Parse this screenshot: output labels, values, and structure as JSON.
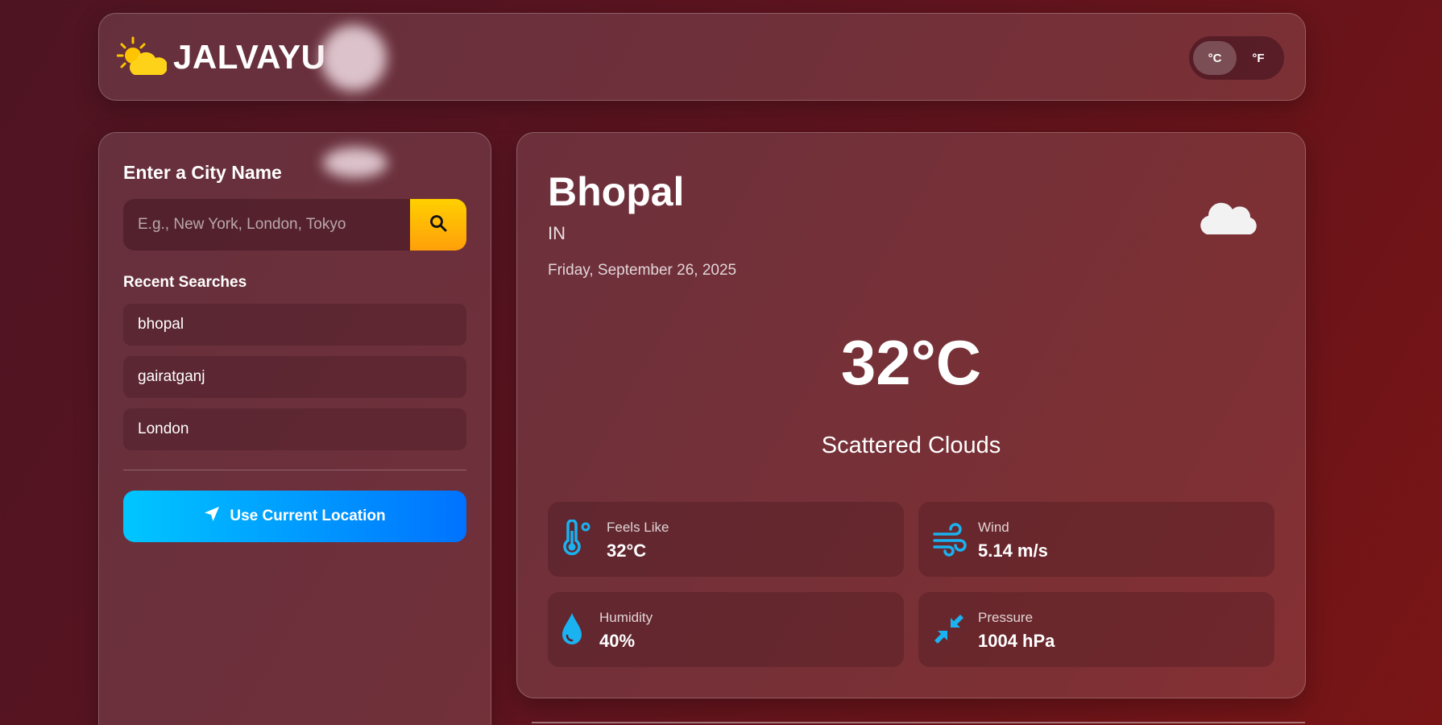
{
  "app": {
    "name": "JALVAYU",
    "icon": "sun-cloud-icon"
  },
  "units": {
    "celsius_label": "°C",
    "fahrenheit_label": "°F",
    "selected": "°C"
  },
  "sidebar": {
    "title": "Enter a City Name",
    "search_placeholder": "E.g., New York, London, Tokyo",
    "search_value": "",
    "recent_title": "Recent Searches",
    "recent": [
      "bhopal",
      "gairatganj",
      "London"
    ],
    "location_button": "Use Current Location"
  },
  "weather": {
    "city": "Bhopal",
    "country": "IN",
    "date": "Friday, September 26, 2025",
    "temperature": "32°C",
    "description": "Scattered Clouds",
    "icon": "cloud-icon",
    "stats": {
      "feels_like": {
        "label": "Feels Like",
        "value": "32°C",
        "icon": "thermometer-icon"
      },
      "wind": {
        "label": "Wind",
        "value": "5.14 m/s",
        "icon": "wind-icon"
      },
      "humidity": {
        "label": "Humidity",
        "value": "40%",
        "icon": "droplet-icon"
      },
      "pressure": {
        "label": "Pressure",
        "value": "1004 hPa",
        "icon": "compress-icon"
      }
    }
  },
  "colors": {
    "accent_yellow": "#ffc107",
    "accent_blue": "#00b4ff",
    "location_gradient_start": "#00c6ff",
    "location_gradient_end": "#0072ff"
  }
}
